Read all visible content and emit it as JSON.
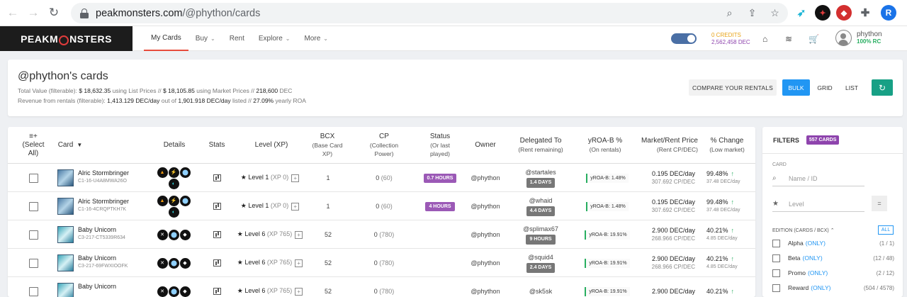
{
  "browser": {
    "url_host": "peakmonsters.com",
    "url_path": "/@phython/cards",
    "profile_initial": "R"
  },
  "app": {
    "logo_pre": "PEAKM",
    "logo_post": "NSTERS",
    "menu": [
      {
        "label": "My Cards",
        "caret": false
      },
      {
        "label": "Buy",
        "caret": true
      },
      {
        "label": "Rent",
        "caret": false
      },
      {
        "label": "Explore",
        "caret": true
      },
      {
        "label": "More",
        "caret": true
      }
    ],
    "credits": "0 CREDITS",
    "dec": "2,562,458 DEC",
    "username": "phython",
    "rc": "100% RC"
  },
  "summary": {
    "title": "@phython's cards",
    "line1": {
      "l1": "Total Value (filterable):",
      "v1": "$ 18,632.35",
      "l2": "using List Prices //",
      "v2": "$ 18,105.85",
      "l3": "using Market Prices //",
      "v3": "218,600",
      "l4": "DEC"
    },
    "line2": {
      "l1": "Revenue from rentals (filterable):",
      "v1": "1,413.129 DEC/day",
      "l2": "out of",
      "v2": "1,901.918 DEC/day",
      "l3": "listed //",
      "v3": "27.09%",
      "l4": "yearly ROA"
    },
    "compare_label": "COMPARE YOUR RENTALS",
    "views": [
      "BULK",
      "GRID",
      "LIST"
    ]
  },
  "table": {
    "headers": {
      "select": "(Select All)",
      "select_icon": "≡+",
      "card": "Card",
      "details": "Details",
      "stats": "Stats",
      "level": "Level (XP)",
      "bcx": "BCX",
      "bcx_sub": "(Base Card XP)",
      "cp": "CP",
      "cp_sub": "(Collection Power)",
      "status": "Status",
      "status_sub": "(Or last played)",
      "owner": "Owner",
      "delegated": "Delegated To",
      "delegated_sub": "(Rent remaining)",
      "yroa": "yROA-B %",
      "yroa_sub": "(On rentals)",
      "price": "Market/Rent Price",
      "price_sub": "(Rent CP/DEC)",
      "change": "% Change",
      "change_sub": "(Low market)"
    },
    "rows": [
      {
        "name": "Alric Stormbringer",
        "id": "C1-16-U4A8MWA26O",
        "art": "alric",
        "level": "Level 1",
        "xp": "(XP 0)",
        "bcx": "1",
        "cp": "0",
        "cp_dim": "(60)",
        "status": "0.7 HOURS",
        "owner": "@phython",
        "deleg": "@startales",
        "days": "1.4 DAYS",
        "yroa": "yROA-B: 1.48%",
        "price": "0.195 DEC/day",
        "cpdec": "307.692 CP/DEC",
        "change": "99.48%",
        "change_low": "37.48 DEC/day"
      },
      {
        "name": "Alric Stormbringer",
        "id": "C1-16-4CRQPTKH7K",
        "art": "alric",
        "level": "Level 1",
        "xp": "(XP 0)",
        "bcx": "1",
        "cp": "0",
        "cp_dim": "(60)",
        "status": "4 HOURS",
        "owner": "@phython",
        "deleg": "@whaid",
        "days": "4.4 DAYS",
        "yroa": "yROA-B: 1.48%",
        "price": "0.195 DEC/day",
        "cpdec": "307.692 CP/DEC",
        "change": "99.48%",
        "change_low": "37.48 DEC/day"
      },
      {
        "name": "Baby Unicorn",
        "id": "C3-217-CT5339R634",
        "art": "unicorn",
        "level": "Level 6",
        "xp": "(XP 765)",
        "bcx": "52",
        "cp": "0",
        "cp_dim": "(780)",
        "status": "",
        "owner": "@phython",
        "deleg": "@splimax67",
        "days": "9 HOURS",
        "yroa": "yROA-B: 19.91%",
        "price": "2.900 DEC/day",
        "cpdec": "268.966 CP/DEC",
        "change": "40.21%",
        "change_low": "4.85 DEC/day"
      },
      {
        "name": "Baby Unicorn",
        "id": "C3-217-69FWXIOOFK",
        "art": "unicorn",
        "level": "Level 6",
        "xp": "(XP 765)",
        "bcx": "52",
        "cp": "0",
        "cp_dim": "(780)",
        "status": "",
        "owner": "@phython",
        "deleg": "@squid4",
        "days": "2.4 DAYS",
        "yroa": "yROA-B: 19.91%",
        "price": "2.900 DEC/day",
        "cpdec": "268.966 CP/DEC",
        "change": "40.21%",
        "change_low": "4.85 DEC/day"
      },
      {
        "name": "Baby Unicorn",
        "id": "",
        "art": "unicorn",
        "level": "Level 6",
        "xp": "(XP 765)",
        "bcx": "52",
        "cp": "0",
        "cp_dim": "(780)",
        "status": "",
        "owner": "@phython",
        "deleg": "@sk5sk",
        "days": "",
        "yroa": "yROA-B: 19.91%",
        "price": "2.900 DEC/day",
        "cpdec": "",
        "change": "40.21%",
        "change_low": ""
      }
    ]
  },
  "filters": {
    "title": "FILTERS",
    "count": "557 CARDS",
    "card_label": "CARD",
    "name_placeholder": "Name / ID",
    "level_placeholder": "Level",
    "eq": "=",
    "edition_label": "EDITION (CARDS / BCX)",
    "all": "ALL",
    "editions": [
      {
        "name": "Alpha",
        "only": "(ONLY)",
        "count": "(1 / 1)"
      },
      {
        "name": "Beta",
        "only": "(ONLY)",
        "count": "(12 / 48)"
      },
      {
        "name": "Promo",
        "only": "(ONLY)",
        "count": "(2 / 12)"
      },
      {
        "name": "Reward",
        "only": "(ONLY)",
        "count": "(504 / 4578)"
      }
    ]
  }
}
